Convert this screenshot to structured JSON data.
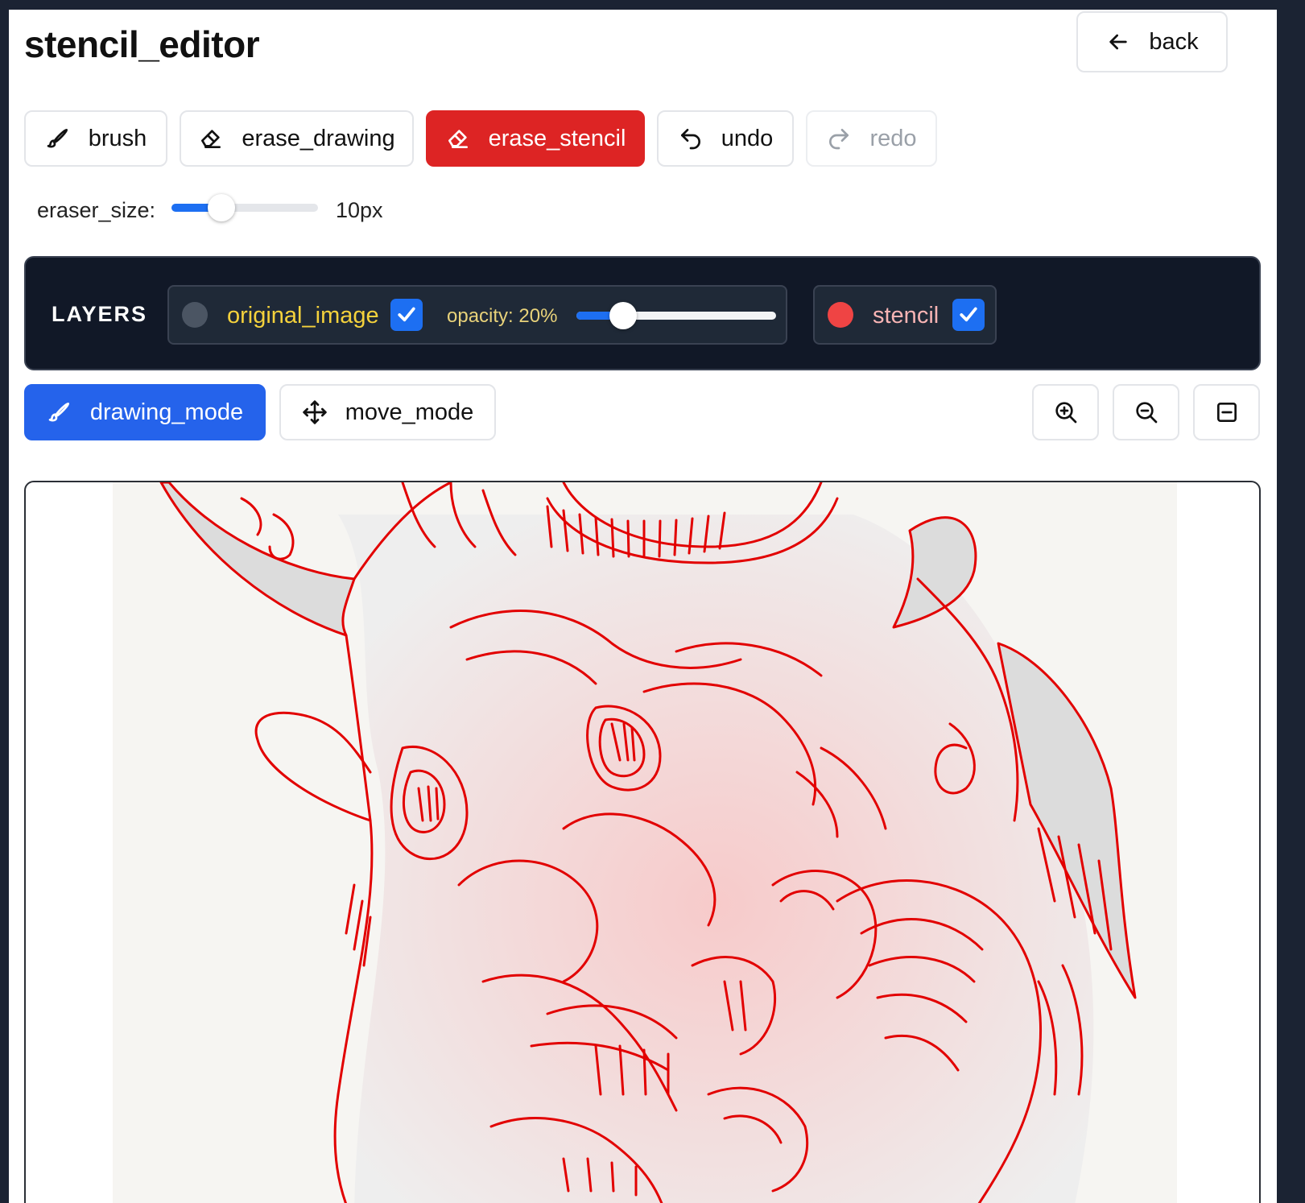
{
  "header": {
    "title": "stencil_editor",
    "back_label": "back"
  },
  "tools": {
    "brush": "brush",
    "erase_drawing": "erase_drawing",
    "erase_stencil": "erase_stencil",
    "undo": "undo",
    "redo": "redo",
    "active": "erase_stencil"
  },
  "eraser": {
    "label": "eraser_size:",
    "value_text": "10px",
    "value_fraction": 0.33
  },
  "layers": {
    "title": "LAYERS",
    "items": [
      {
        "name": "original_image",
        "checked": true,
        "dot_color": "#4b5563",
        "text_color": "#f5d23c"
      },
      {
        "name": "stencil",
        "checked": true,
        "dot_color": "#ef4444",
        "text_color": "#f8b4b4"
      }
    ],
    "opacity_label": "opacity: 20%",
    "opacity_fraction": 0.22
  },
  "modes": {
    "drawing": "drawing_mode",
    "move": "move_mode",
    "active": "drawing_mode"
  },
  "zoom_controls": [
    "zoom-in-icon",
    "zoom-out-icon",
    "fit-to-screen-icon"
  ],
  "colors": {
    "accent_blue": "#2563eb",
    "danger_red": "#dd2424",
    "stencil_red": "#e00000",
    "dark_panel": "#111827"
  }
}
